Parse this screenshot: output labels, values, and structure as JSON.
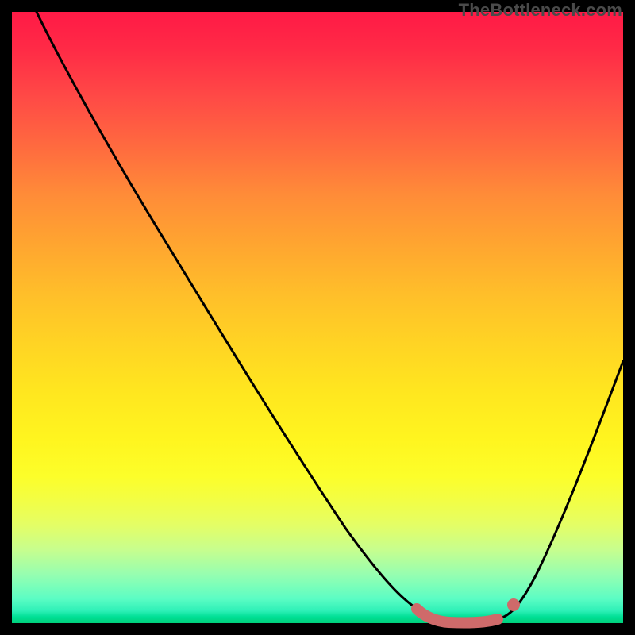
{
  "watermark": "TheBottleneck.com",
  "chart_data": {
    "type": "line",
    "title": "",
    "xlabel": "",
    "ylabel": "",
    "xlim": [
      0,
      100
    ],
    "ylim": [
      0,
      100
    ],
    "grid": false,
    "legend": false,
    "series": [
      {
        "name": "bottleneck-curve",
        "color": "#000000",
        "x": [
          4,
          10,
          18,
          26,
          34,
          42,
          50,
          56,
          60,
          64,
          68,
          72,
          76,
          80,
          84,
          88,
          92,
          96,
          100
        ],
        "y": [
          100,
          90,
          78,
          66,
          54,
          42,
          30,
          20,
          14,
          8,
          4,
          1,
          0,
          0,
          2,
          10,
          24,
          40,
          56
        ]
      }
    ],
    "highlight": {
      "name": "optimal-range",
      "color": "#d66a6a",
      "x": [
        68,
        72,
        76,
        80,
        83
      ],
      "y": [
        4,
        1,
        0,
        0,
        2
      ]
    }
  },
  "gradient": {
    "top": "#ff1a46",
    "mid": "#ffe61f",
    "bottom": "#00d07a"
  }
}
